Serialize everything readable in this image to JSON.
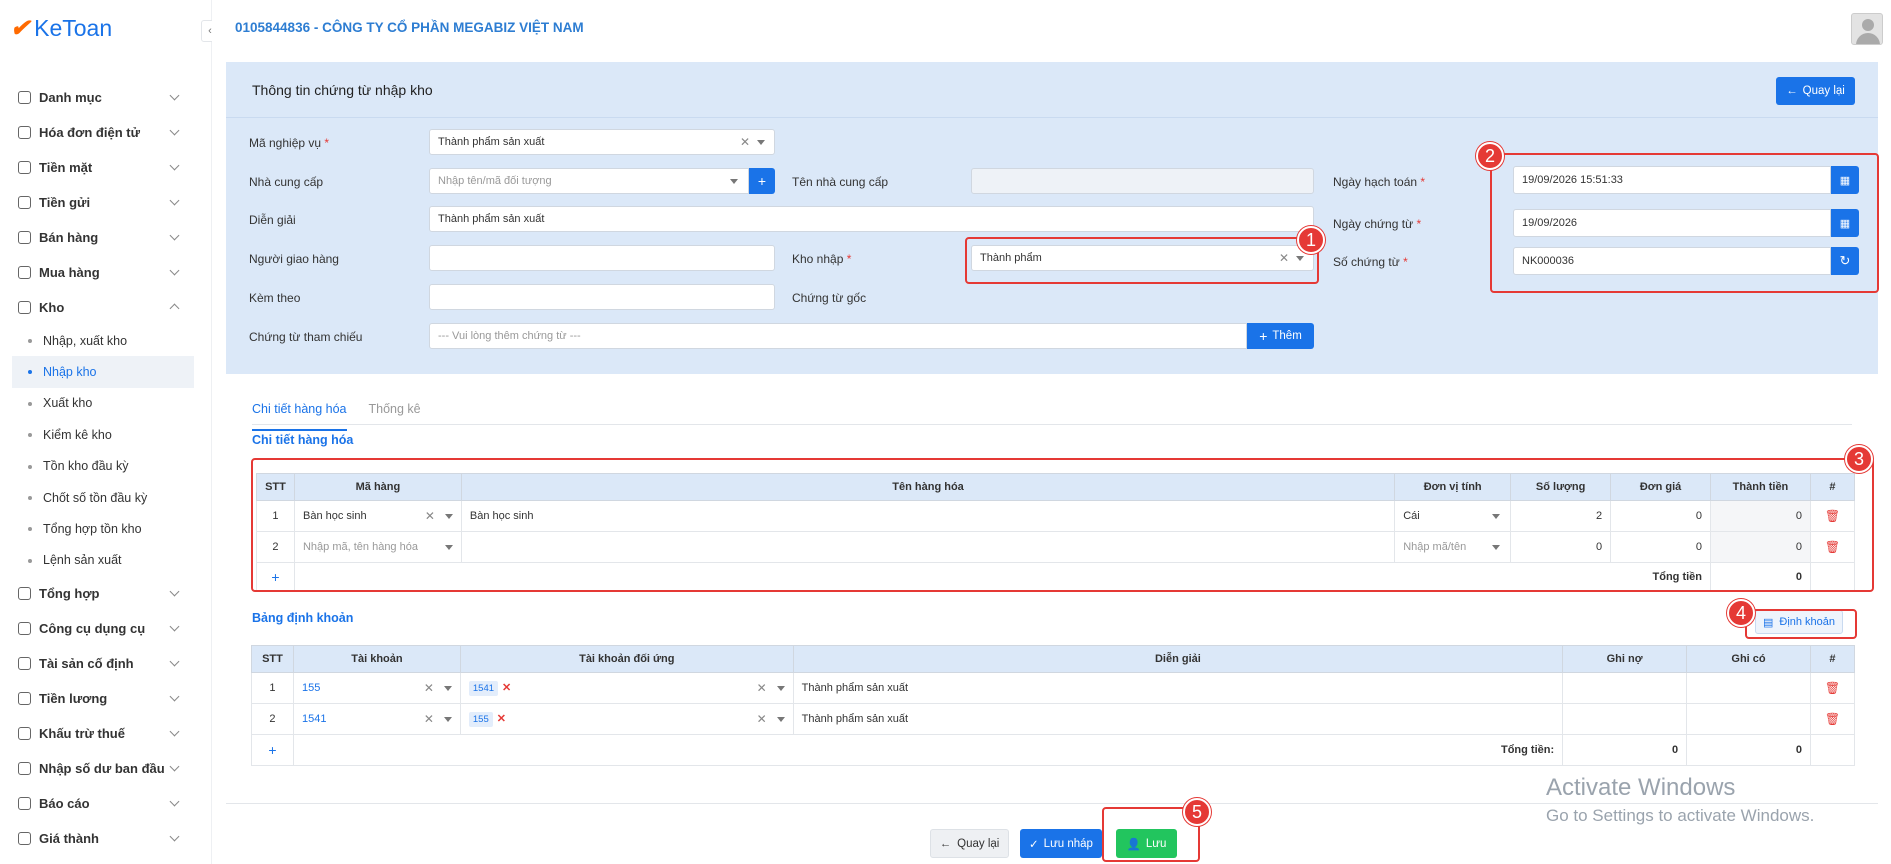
{
  "app": {
    "logo_mark": "✔",
    "logo_text": "KeToan",
    "company": "0105844836 - CÔNG TY CỔ PHẦN MEGABIZ VIỆT NAM"
  },
  "sidebar": {
    "items": [
      {
        "label": "Danh mục"
      },
      {
        "label": "Hóa đơn điện tử"
      },
      {
        "label": "Tiền mặt"
      },
      {
        "label": "Tiền gửi"
      },
      {
        "label": "Bán hàng"
      },
      {
        "label": "Mua hàng"
      },
      {
        "label": "Kho"
      }
    ],
    "kho_sub": [
      {
        "label": "Nhập, xuất kho"
      },
      {
        "label": "Nhập kho"
      },
      {
        "label": "Xuất kho"
      },
      {
        "label": "Kiểm kê kho"
      },
      {
        "label": "Tồn kho đầu kỳ"
      },
      {
        "label": "Chốt số tồn đầu kỳ"
      },
      {
        "label": "Tổng hợp tồn kho"
      },
      {
        "label": "Lệnh sản xuất"
      }
    ],
    "items_after": [
      {
        "label": "Tổng hợp"
      },
      {
        "label": "Công cụ dụng cụ"
      },
      {
        "label": "Tài sản cố định"
      },
      {
        "label": "Tiền lương"
      },
      {
        "label": "Khấu trừ thuế"
      },
      {
        "label": "Nhập số dư ban đầu"
      },
      {
        "label": "Báo cáo"
      },
      {
        "label": "Giá thành"
      }
    ]
  },
  "form": {
    "title": "Thông tin chứng từ nhập kho",
    "back_label": "Quay lại",
    "labels": {
      "ma_nghiep_vu": "Mã nghiệp vụ",
      "nha_cung_cap": "Nhà cung cấp",
      "ten_ncc": "Tên nhà cung cấp",
      "dien_giai": "Diễn giải",
      "nguoi_giao": "Người giao hàng",
      "kho_nhap": "Kho nhập",
      "kem_theo": "Kèm theo",
      "chung_tu_goc": "Chứng từ gốc",
      "tham_chieu": "Chứng từ tham chiếu",
      "ngay_hach_toan": "Ngày hạch toán",
      "ngay_chung_tu": "Ngày chứng từ",
      "so_chung_tu": "Số chứng từ",
      "required_mark": "*"
    },
    "values": {
      "ma_nghiep_vu": "Thành phẩm sản xuất",
      "nha_cung_cap_placeholder": "Nhập tên/mã đối tượng",
      "dien_giai": "Thành phẩm sản xuất",
      "kho_nhap": "Thành phẩm",
      "tham_chieu_placeholder": "--- Vui lòng thêm chứng từ ---",
      "them_label": "Thêm",
      "ngay_hach_toan": "19/09/2026 15:51:33",
      "ngay_chung_tu": "19/09/2026",
      "so_chung_tu": "NK000036"
    }
  },
  "tabs": [
    {
      "label": "Chi tiết hàng hóa"
    },
    {
      "label": "Thống kê"
    }
  ],
  "goods": {
    "section_title": "Chi tiết hàng hóa",
    "headers": [
      "STT",
      "Mã hàng",
      "Tên hàng hóa",
      "Đơn vị tính",
      "Số lượng",
      "Đơn giá",
      "Thành tiền",
      "#"
    ],
    "rows": [
      {
        "stt": "1",
        "ma": "Bàn học sinh",
        "ten": "Bàn học sinh",
        "dvt": "Cái",
        "sl": "2",
        "dg": "0",
        "tt": "0"
      },
      {
        "stt": "2",
        "ma_placeholder": "Nhập mã, tên hàng hóa",
        "ten": "",
        "dvt_placeholder": "Nhập mã/tên",
        "sl": "0",
        "dg": "0",
        "tt": "0"
      }
    ],
    "total_label": "Tổng tiền",
    "total_value": "0"
  },
  "accounting": {
    "section_title": "Bảng định khoản",
    "dinh_khoan_label": "Định khoản",
    "headers": [
      "STT",
      "Tài khoản",
      "Tài khoản đối ứng",
      "Diễn giải",
      "Ghi nợ",
      "Ghi có",
      "#"
    ],
    "rows": [
      {
        "stt": "1",
        "tk": "155",
        "doi_ung": "1541",
        "dien_giai": "Thành phẩm sản xuất",
        "no": "",
        "co": ""
      },
      {
        "stt": "2",
        "tk": "1541",
        "doi_ung": "155",
        "dien_giai": "Thành phẩm sản xuất",
        "no": "",
        "co": ""
      }
    ],
    "total_label": "Tổng tiền:",
    "total_no": "0",
    "total_co": "0"
  },
  "footer": {
    "back_label": "Quay lại",
    "save_draft_label": "Lưu nháp",
    "save_label": "Lưu"
  },
  "annotations": [
    "1",
    "2",
    "3",
    "4",
    "5"
  ],
  "watermark": {
    "line1": "Activate Windows",
    "line2": "Go to Settings to activate Windows."
  },
  "colors": {
    "primary": "#1a73e8",
    "annotation": "#e53935",
    "success": "#22c55e",
    "card_bg": "#dbe8f8"
  }
}
